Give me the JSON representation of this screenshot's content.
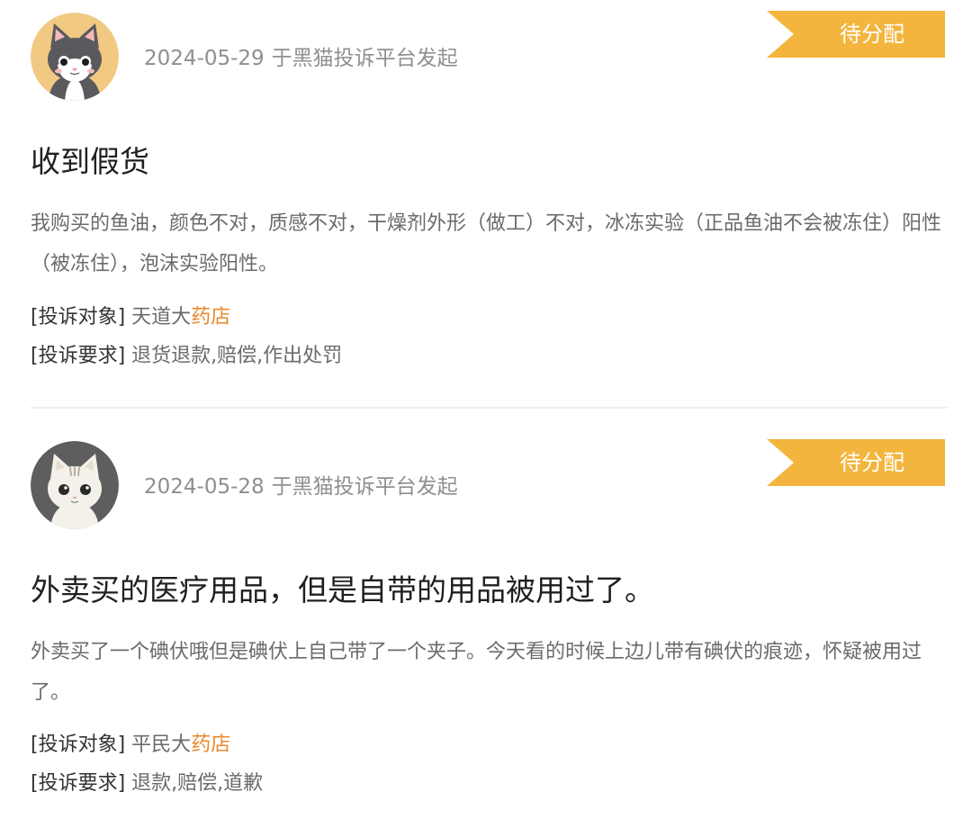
{
  "colors": {
    "status_ribbon": "#f3b53d",
    "highlight": "#e8892e",
    "meta_text": "#8f8f8f"
  },
  "complaints": [
    {
      "avatar_icon": "gray-tuxedo-cat-avatar",
      "date": "2024-05-29",
      "source_text": "于黑猫投诉平台发起",
      "status": "待分配",
      "title": "收到假货",
      "description": "我购买的鱼油，颜色不对，质感不对，干燥剂外形（做工）不对，冰冻实验（正品鱼油不会被冻住）阳性（被冻住），泡沫实验阳性。",
      "target_label": "[投诉对象]",
      "target_name": "天道大",
      "target_highlight": "药店",
      "request_label": "[投诉要求]",
      "request_value": "退货退款,赔偿,作出处罚"
    },
    {
      "avatar_icon": "white-tabby-cat-avatar",
      "date": "2024-05-28",
      "source_text": "于黑猫投诉平台发起",
      "status": "待分配",
      "title": "外卖买的医疗用品，但是自带的用品被用过了。",
      "description": "外卖买了一个碘伏哦但是碘伏上自己带了一个夹子。今天看的时候上边儿带有碘伏的痕迹，怀疑被用过了。",
      "target_label": "[投诉对象]",
      "target_name": "平民大",
      "target_highlight": "药店",
      "request_label": "[投诉要求]",
      "request_value": "退款,赔偿,道歉"
    }
  ]
}
